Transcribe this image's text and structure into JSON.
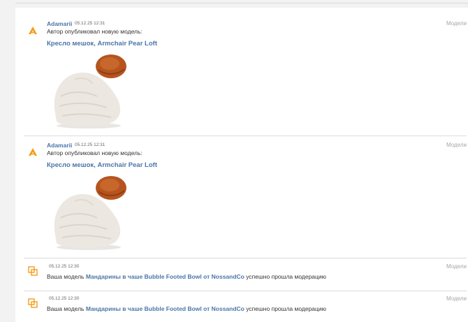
{
  "feed": {
    "items": [
      {
        "type": "publish",
        "icon": "artist-logo-icon",
        "author": "Adamarii",
        "timestamp": "05.12.25 12:31",
        "category": "Модели",
        "action": "Автор опубликовал новую модель:",
        "model": "Кресло мешок, Armchair Pear Loft",
        "thumbnail": "beanbag-chair-thumbnail"
      },
      {
        "type": "publish",
        "icon": "artist-logo-icon",
        "author": "Adamarii",
        "timestamp": "05.12.25 12:31",
        "category": "Модели",
        "action": "Автор опубликовал новую модель:",
        "model": "Кресло мешок, Armchair Pear Loft",
        "thumbnail": "beanbag-chair-thumbnail"
      },
      {
        "type": "moderation",
        "icon": "moderation-icon",
        "timestamp": "05.12.25 12:30",
        "category": "Модели",
        "msg_prefix": "Ваша модель",
        "model": "Мандарины в чаше Bubble Footed Bowl от NossandCo",
        "msg_suffix": "успешно прошла модерацию"
      },
      {
        "type": "moderation",
        "icon": "moderation-icon",
        "timestamp": "05.12.25 12:30",
        "category": "Модели",
        "msg_prefix": "Ваша модель",
        "model": "Мандарины в чаше Bubble Footed Bowl от NossandCo",
        "msg_suffix": "успешно прошла модерацию"
      }
    ]
  },
  "colors": {
    "link": "#4a76a8",
    "icon_orange": "#f39c1a",
    "muted": "#a6a6a6"
  }
}
